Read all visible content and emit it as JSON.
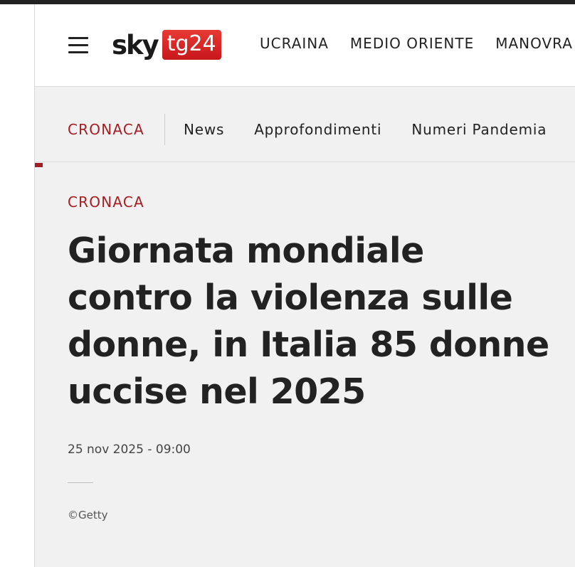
{
  "header": {
    "menu_icon": "hamburger-menu-icon",
    "logo": {
      "sky": "sky",
      "tg": "tg24"
    },
    "nav": [
      "UCRAINA",
      "MEDIO ORIENTE",
      "MANOVRA"
    ]
  },
  "subnav": {
    "section": "CRONACA",
    "items": [
      "News",
      "Approfondimenti",
      "Numeri Pandemia"
    ]
  },
  "article": {
    "kicker": "CRONACA",
    "headline": "Giornata mondiale contro la violenza sulle donne, in Italia 85 donne uccise nel 2025",
    "date": "25 nov 2025 - 09:00",
    "credit": "©Getty"
  },
  "colors": {
    "accent": "#a51d21",
    "logo_red": "#d51f23",
    "background": "#f1f1f1"
  }
}
